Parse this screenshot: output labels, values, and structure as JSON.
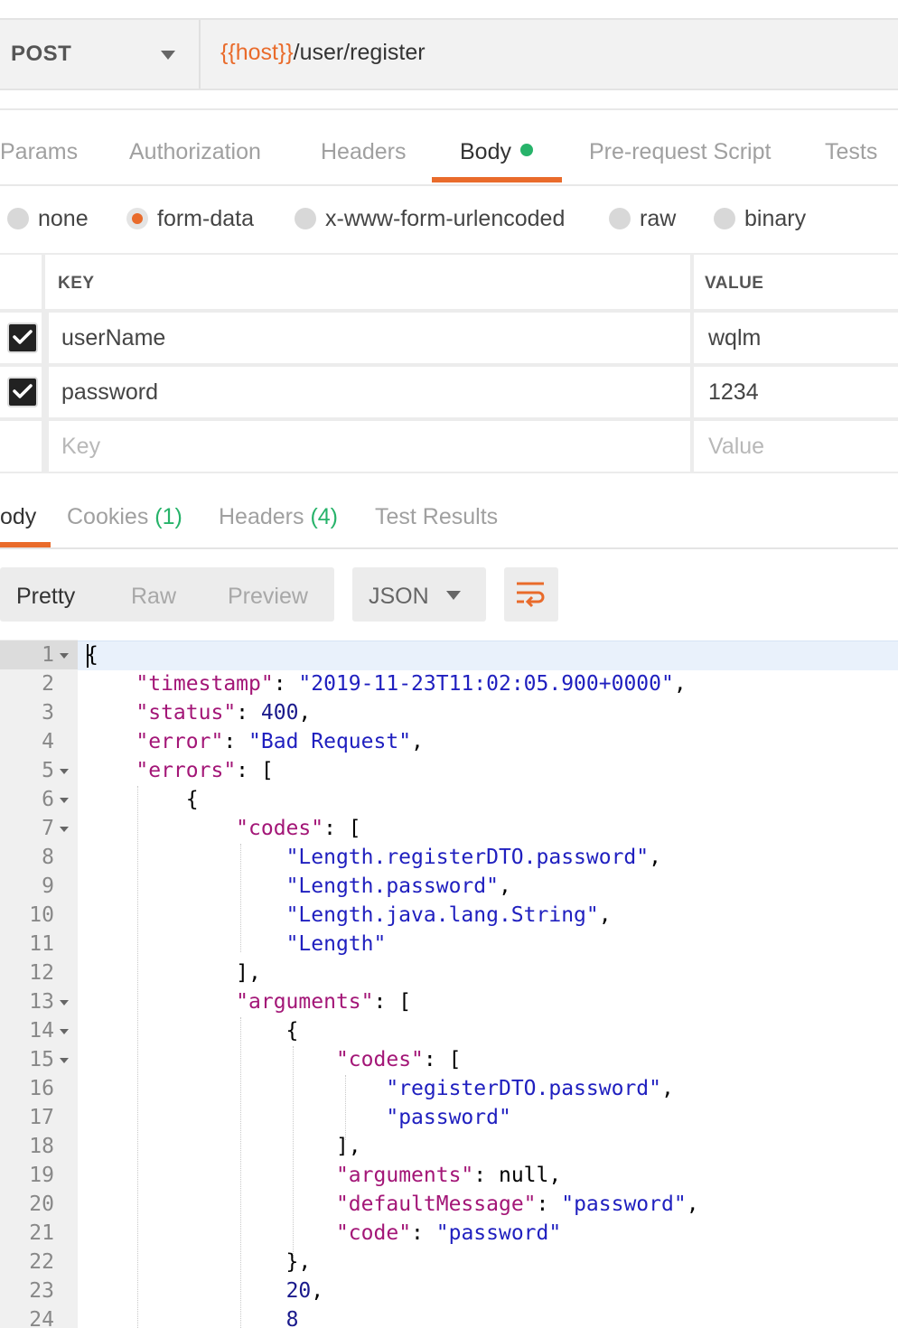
{
  "request": {
    "method": "POST",
    "url_var": "{{host}}",
    "url_path": "/user/register"
  },
  "request_tabs": [
    {
      "label": "Params"
    },
    {
      "label": "Authorization"
    },
    {
      "label": "Headers"
    },
    {
      "label": "Body",
      "active": true
    },
    {
      "label": "Pre-request Script"
    },
    {
      "label": "Tests"
    }
  ],
  "body_types": [
    {
      "label": "none",
      "selected": false
    },
    {
      "label": "form-data",
      "selected": true
    },
    {
      "label": "x-www-form-urlencoded",
      "selected": false
    },
    {
      "label": "raw",
      "selected": false
    },
    {
      "label": "binary",
      "selected": false
    }
  ],
  "kv_table": {
    "key_header": "KEY",
    "value_header": "VALUE",
    "rows": [
      {
        "checked": true,
        "key": "userName",
        "value": "wqlm"
      },
      {
        "checked": true,
        "key": "password",
        "value": "1234"
      }
    ],
    "key_placeholder": "Key",
    "value_placeholder": "Value"
  },
  "response_tabs": {
    "body": "ody",
    "cookies": "Cookies",
    "cookies_count": "(1)",
    "headers": "Headers",
    "headers_count": "(4)",
    "test_results": "Test Results"
  },
  "view_modes": [
    "Pretty",
    "Raw",
    "Preview"
  ],
  "format": "JSON",
  "editor_lines": [
    {
      "n": "1",
      "fold": true
    },
    {
      "n": "2"
    },
    {
      "n": "3"
    },
    {
      "n": "4"
    },
    {
      "n": "5",
      "fold": true
    },
    {
      "n": "6",
      "fold": true
    },
    {
      "n": "7",
      "fold": true
    },
    {
      "n": "8"
    },
    {
      "n": "9"
    },
    {
      "n": "10"
    },
    {
      "n": "11"
    },
    {
      "n": "12"
    },
    {
      "n": "13",
      "fold": true
    },
    {
      "n": "14",
      "fold": true
    },
    {
      "n": "15",
      "fold": true
    },
    {
      "n": "16"
    },
    {
      "n": "17"
    },
    {
      "n": "18"
    },
    {
      "n": "19"
    },
    {
      "n": "20"
    },
    {
      "n": "21"
    },
    {
      "n": "22"
    },
    {
      "n": "23"
    },
    {
      "n": "24"
    }
  ],
  "json": {
    "timestamp_key": "\"timestamp\"",
    "timestamp_val": "\"2019-11-23T11:02:05.900+0000\"",
    "status_key": "\"status\"",
    "status_val": "400",
    "error_key": "\"error\"",
    "error_val": "\"Bad Request\"",
    "errors_key": "\"errors\"",
    "codes_key": "\"codes\"",
    "code_1": "\"Length.registerDTO.password\"",
    "code_2": "\"Length.password\"",
    "code_3": "\"Length.java.lang.String\"",
    "code_4": "\"Length\"",
    "arguments_key": "\"arguments\"",
    "inner_code_1": "\"registerDTO.password\"",
    "inner_code_2": "\"password\"",
    "inner_arguments_val": "null",
    "default_message_key": "\"defaultMessage\"",
    "default_message_val": "\"password\"",
    "code_key": "\"code\"",
    "code_val": "\"password\"",
    "num_20": "20",
    "num_8": "8"
  },
  "colors": {
    "accent": "#e96b2b",
    "success": "#27b36a",
    "json_key": "#a31677",
    "json_string": "#1f1fbf"
  }
}
